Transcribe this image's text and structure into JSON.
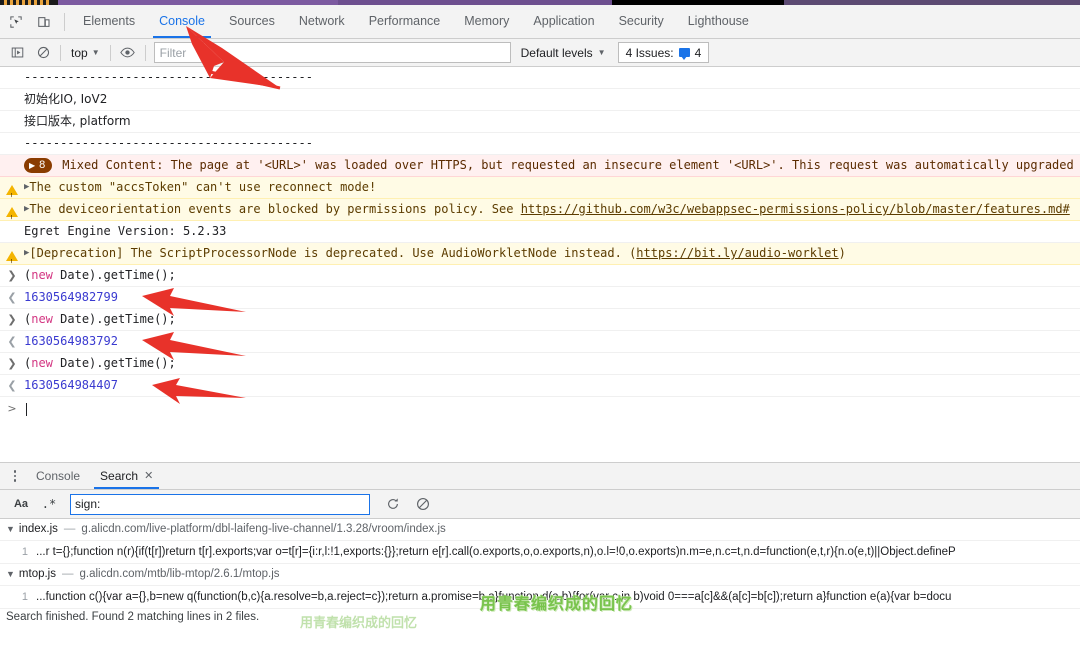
{
  "devtools": {
    "tabs": [
      {
        "label": "Elements",
        "active": false
      },
      {
        "label": "Console",
        "active": true
      },
      {
        "label": "Sources",
        "active": false
      },
      {
        "label": "Network",
        "active": false
      },
      {
        "label": "Performance",
        "active": false
      },
      {
        "label": "Memory",
        "active": false
      },
      {
        "label": "Application",
        "active": false
      },
      {
        "label": "Security",
        "active": false
      },
      {
        "label": "Lighthouse",
        "active": false
      }
    ],
    "icons": {
      "inspect": "inspect-element-icon",
      "device": "device-toolbar-icon"
    }
  },
  "console_toolbar": {
    "execute_icon": "execute-script-icon",
    "clear_icon": "clear-console-icon",
    "context": "top",
    "eye_icon": "live-expression-icon",
    "filter_placeholder": "Filter",
    "filter_value": "",
    "levels_label": "Default levels",
    "issues_label": "4 Issues:",
    "issues_count": "4"
  },
  "console_messages": [
    {
      "type": "plain",
      "text": "----------------------------------------"
    },
    {
      "type": "plain_cn",
      "text": "初始化IO, IoV2"
    },
    {
      "type": "plain_cn",
      "text": "接口版本, platform"
    },
    {
      "type": "plain",
      "text": "----------------------------------------"
    },
    {
      "type": "group_error",
      "badge": "8",
      "text": "Mixed Content: The page at '<URL>' was loaded over HTTPS, but requested an insecure element '<URL>'. This request was automatically upgraded t"
    },
    {
      "type": "warn",
      "text": "The custom \"accsToken\" can't use reconnect mode!"
    },
    {
      "type": "warn_link",
      "text": "The deviceorientation events are blocked by permissions policy. See ",
      "link": "https://github.com/w3c/webappsec-permissions-policy/blob/master/features.md#"
    },
    {
      "type": "plain",
      "text": "Egret Engine Version: 5.2.33"
    },
    {
      "type": "warn_link",
      "text": "[Deprecation] The ScriptProcessorNode is deprecated. Use AudioWorkletNode instead. (",
      "link": "https://bit.ly/audio-worklet",
      "suffix": ")"
    },
    {
      "type": "input",
      "kw": "new",
      "pre": "(",
      "post": " Date).getTime();"
    },
    {
      "type": "output",
      "text": "1630564982799"
    },
    {
      "type": "input",
      "kw": "new",
      "pre": "(",
      "post": " Date).getTime();"
    },
    {
      "type": "output",
      "text": "1630564983792"
    },
    {
      "type": "input",
      "kw": "new",
      "pre": "(",
      "post": " Date).getTime();"
    },
    {
      "type": "output",
      "text": "1630564984407"
    }
  ],
  "prompt": {
    "symbol": ">",
    "value": ""
  },
  "drawer": {
    "kebab_icon": "more-options-icon",
    "tabs": [
      {
        "label": "Console",
        "active": false,
        "closable": false
      },
      {
        "label": "Search",
        "active": true,
        "closable": true
      }
    ],
    "close_glyph": "✕"
  },
  "search": {
    "match_case_label": "Aa",
    "regex_label": ".*",
    "query": "sign:",
    "refresh_icon": "refresh-icon",
    "clear_icon": "clear-icon",
    "results": [
      {
        "file": "index.js",
        "dash": "—",
        "url": "g.alicdn.com/live-platform/dbl-laifeng-live-channel/1.3.28/vroom/index.js",
        "line_no": "1",
        "code": "...r t={};function n(r){if(t[r])return t[r].exports;var o=t[r]={i:r,l:!1,exports:{}};return e[r].call(o.exports,o,o.exports,n),o.l=!0,o.exports)n.m=e,n.c=t,n.d=function(e,t,r){n.o(e,t)||Object.defineP"
      },
      {
        "file": "mtop.js",
        "dash": "—",
        "url": "g.alicdn.com/mtb/lib-mtop/2.6.1/mtop.js",
        "line_no": "1",
        "code": "...function c(){var a={},b=new q(function(b,c){a.resolve=b,a.reject=c});return a.promise=b,a}function d(a,b){for(var c in b)void 0===a[c]&&(a[c]=b[c]);return a}function e(a){var b=docu"
      }
    ],
    "status": "Search finished. Found 2 matching lines in 2 files."
  },
  "watermark": {
    "text": "用青春编织成的回忆"
  },
  "colors": {
    "accent": "#1a73e8",
    "warn_bg": "#fffbe5",
    "error_bg": "#fff0f0",
    "toolbar_bg": "#f3f3f3",
    "annotation": "#e8322a"
  }
}
